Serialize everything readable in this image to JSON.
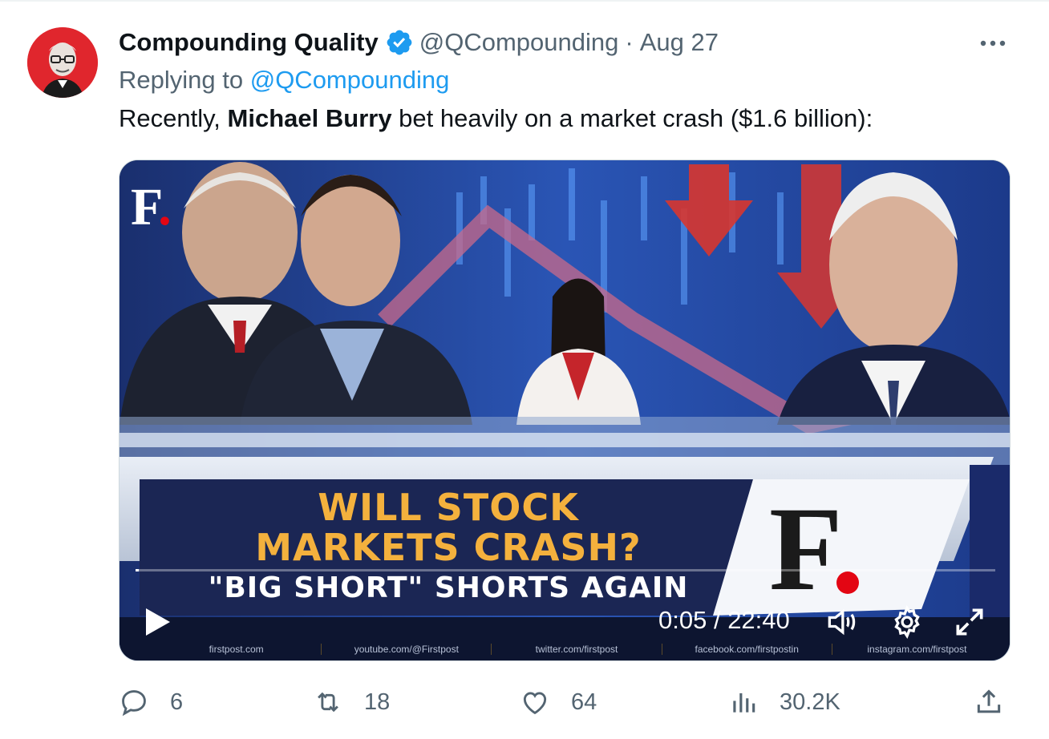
{
  "tweet": {
    "display_name": "Compounding Quality",
    "handle": "@QCompounding",
    "separator": "·",
    "date": "Aug 27",
    "replying_prefix": "Replying to ",
    "replying_to": "@QCompounding",
    "text_before": "Recently, ",
    "text_bold": "Michael Burry",
    "text_after": " bet heavily on a market crash ($1.6 billion):",
    "verified_color": "#1d9bf0"
  },
  "video": {
    "channel_logo": "F",
    "headline_line1": "WILL STOCK",
    "headline_line2": "MARKETS CRASH?",
    "headline_line3": "\"BIG SHORT\" SHORTS AGAIN",
    "big_logo": "F",
    "current_time": "0:05",
    "time_separator": " / ",
    "duration": "22:40",
    "progress_fraction": 0.004,
    "footer_links": [
      "firstpost.com",
      "youtube.com/@Firstpost",
      "twitter.com/firstpost",
      "facebook.com/firstpostin",
      "instagram.com/firstpost"
    ]
  },
  "actions": {
    "replies": "6",
    "retweets": "18",
    "likes": "64",
    "views": "30.2K"
  },
  "icons": [
    "more-icon",
    "verified-badge-icon",
    "play-icon",
    "volume-icon",
    "settings-icon",
    "fullscreen-icon",
    "reply-icon",
    "retweet-icon",
    "like-icon",
    "views-icon",
    "share-icon"
  ]
}
